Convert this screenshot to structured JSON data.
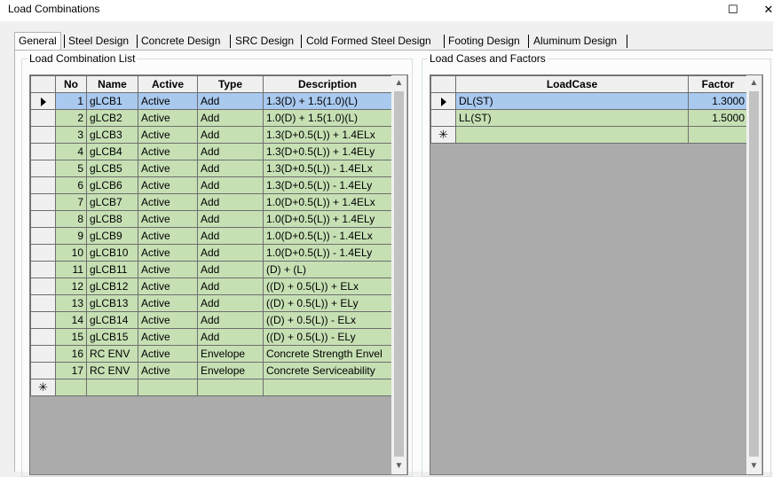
{
  "window": {
    "title": "Load Combinations",
    "maximize_symbol": "☐",
    "close_symbol": "✕"
  },
  "tabs": [
    "General",
    "Steel Design",
    "Concrete Design",
    "SRC Design",
    "Cold Formed Steel Design",
    "Footing Design",
    "Aluminum Design"
  ],
  "left_group": {
    "title": "Load Combination List",
    "columns": [
      "No",
      "Name",
      "Active",
      "Type",
      "Description"
    ],
    "rows": [
      {
        "no": "1",
        "name": "gLCB1",
        "active": "Active",
        "type": "Add",
        "desc": "1.3(D) + 1.5(1.0)(L)"
      },
      {
        "no": "2",
        "name": "gLCB2",
        "active": "Active",
        "type": "Add",
        "desc": "1.0(D) + 1.5(1.0)(L)"
      },
      {
        "no": "3",
        "name": "gLCB3",
        "active": "Active",
        "type": "Add",
        "desc": "1.3(D+0.5(L)) + 1.4ELx"
      },
      {
        "no": "4",
        "name": "gLCB4",
        "active": "Active",
        "type": "Add",
        "desc": "1.3(D+0.5(L)) + 1.4ELy"
      },
      {
        "no": "5",
        "name": "gLCB5",
        "active": "Active",
        "type": "Add",
        "desc": "1.3(D+0.5(L)) - 1.4ELx"
      },
      {
        "no": "6",
        "name": "gLCB6",
        "active": "Active",
        "type": "Add",
        "desc": "1.3(D+0.5(L)) - 1.4ELy"
      },
      {
        "no": "7",
        "name": "gLCB7",
        "active": "Active",
        "type": "Add",
        "desc": "1.0(D+0.5(L)) + 1.4ELx"
      },
      {
        "no": "8",
        "name": "gLCB8",
        "active": "Active",
        "type": "Add",
        "desc": "1.0(D+0.5(L)) + 1.4ELy"
      },
      {
        "no": "9",
        "name": "gLCB9",
        "active": "Active",
        "type": "Add",
        "desc": "1.0(D+0.5(L)) - 1.4ELx"
      },
      {
        "no": "10",
        "name": "gLCB10",
        "active": "Active",
        "type": "Add",
        "desc": "1.0(D+0.5(L)) - 1.4ELy"
      },
      {
        "no": "11",
        "name": "gLCB11",
        "active": "Active",
        "type": "Add",
        "desc": "(D) + (L)"
      },
      {
        "no": "12",
        "name": "gLCB12",
        "active": "Active",
        "type": "Add",
        "desc": "((D) + 0.5(L)) + ELx"
      },
      {
        "no": "13",
        "name": "gLCB13",
        "active": "Active",
        "type": "Add",
        "desc": "((D) + 0.5(L)) + ELy"
      },
      {
        "no": "14",
        "name": "gLCB14",
        "active": "Active",
        "type": "Add",
        "desc": "((D) + 0.5(L)) - ELx"
      },
      {
        "no": "15",
        "name": "gLCB15",
        "active": "Active",
        "type": "Add",
        "desc": "((D) + 0.5(L)) - ELy"
      },
      {
        "no": "16",
        "name": "RC ENV",
        "active": "Active",
        "type": "Envelope",
        "desc": "Concrete Strength Envel"
      },
      {
        "no": "17",
        "name": "RC ENV",
        "active": "Active",
        "type": "Envelope",
        "desc": "Concrete Serviceability"
      }
    ],
    "new_row_symbol": "✳"
  },
  "right_group": {
    "title": "Load Cases and Factors",
    "columns": [
      "LoadCase",
      "Factor"
    ],
    "rows": [
      {
        "case": "DL(ST)",
        "factor": "1.3000"
      },
      {
        "case": "LL(ST)",
        "factor": "1.5000"
      }
    ],
    "new_row_symbol": "✳"
  },
  "scroll": {
    "up": "▲",
    "down": "▼"
  },
  "colors": {
    "cell_green": "#c6e0b4",
    "selection_blue": "#a9c9ef",
    "editing_cell": "#fdfcee"
  }
}
